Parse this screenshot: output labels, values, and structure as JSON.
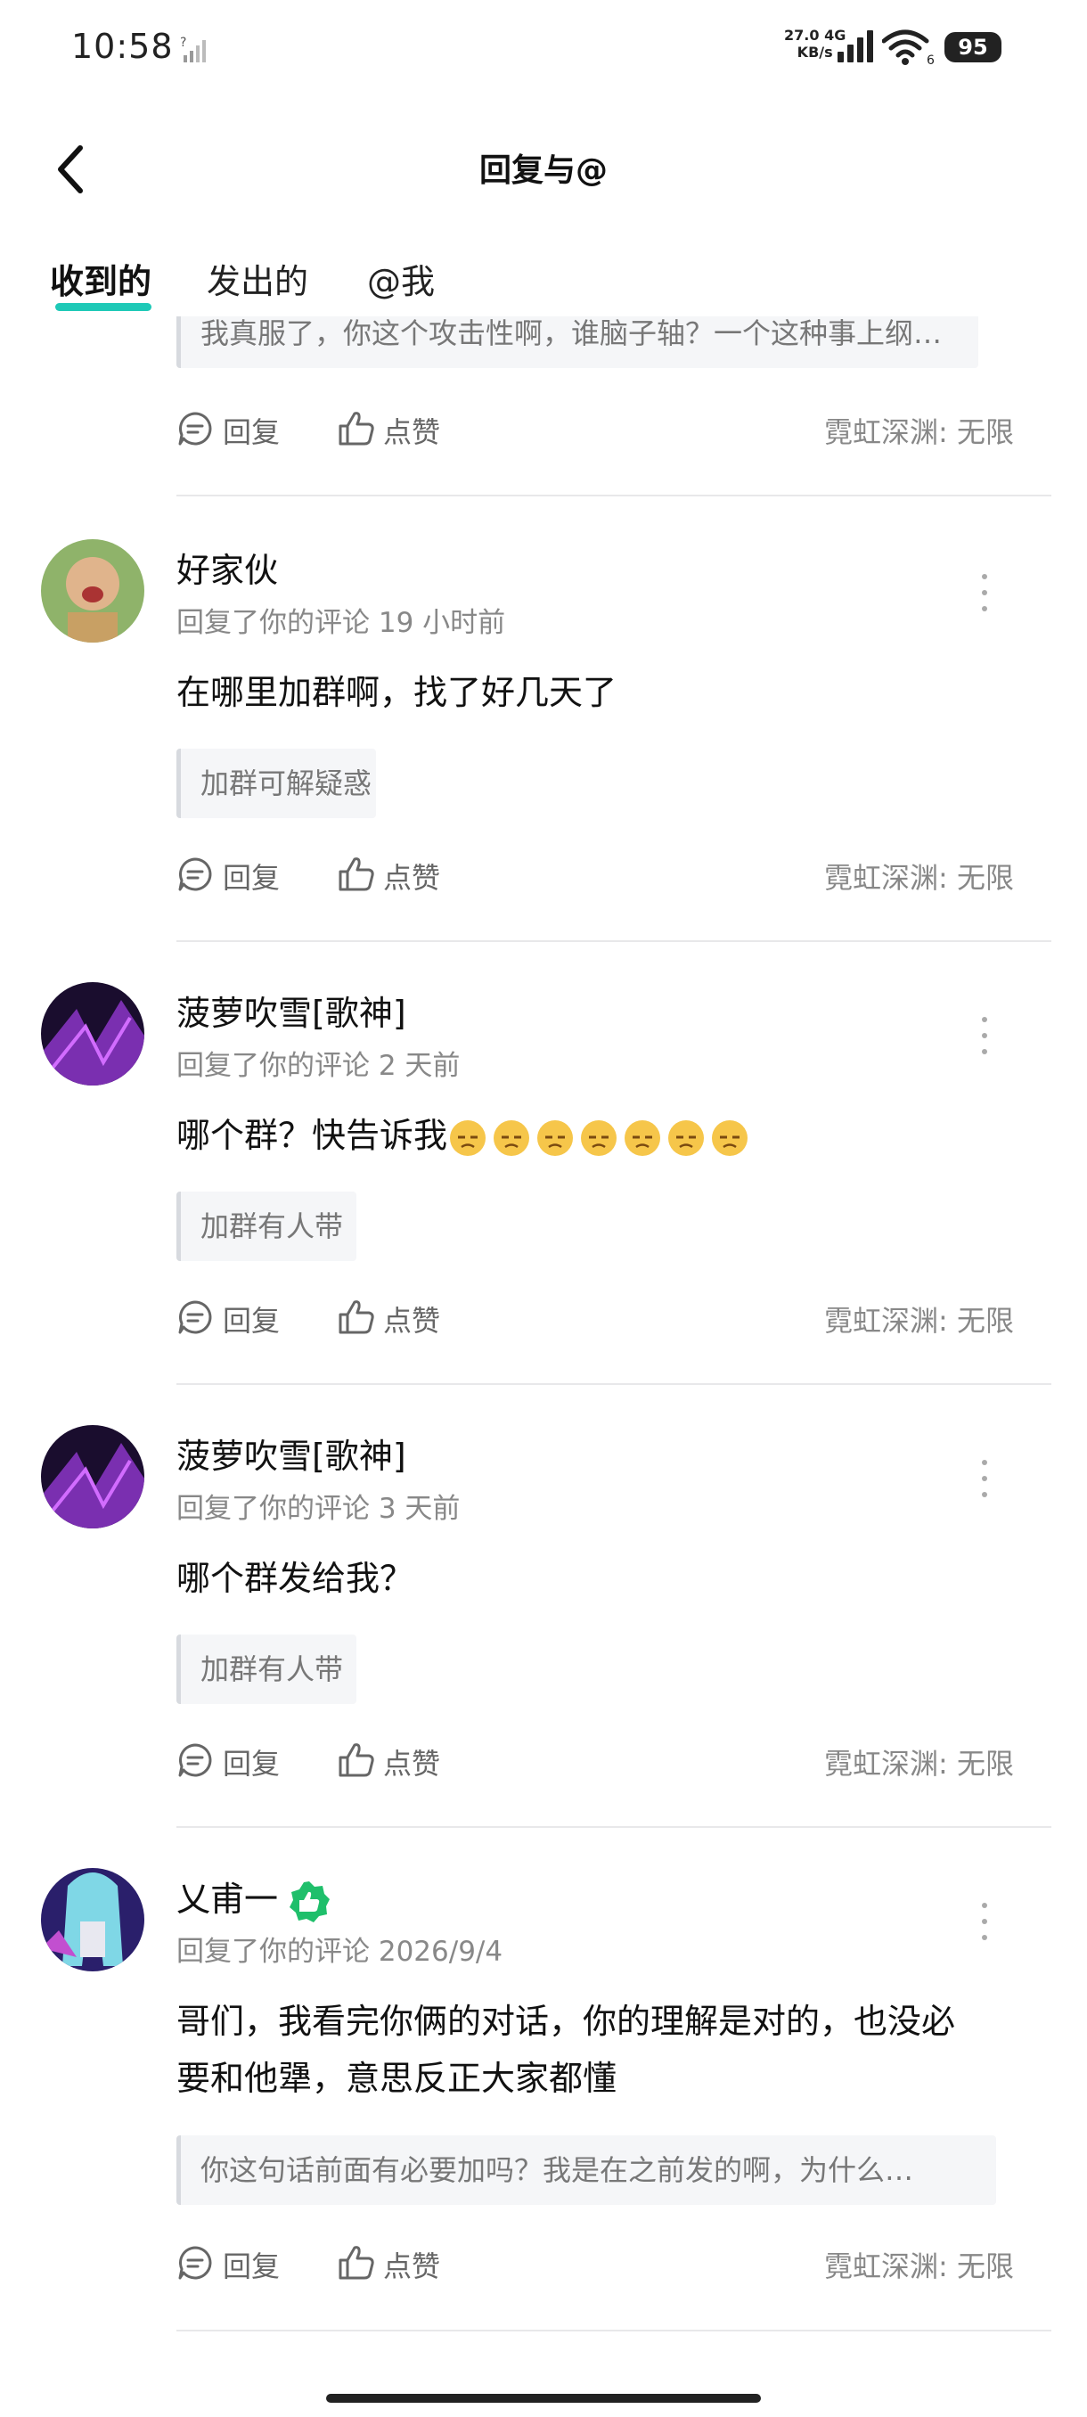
{
  "status_bar": {
    "time": "10:58",
    "net_speed_value": "27.0",
    "net_type": "4G",
    "net_speed_unit": "KB/s",
    "wifi_sub": "6",
    "battery": "95"
  },
  "header": {
    "title": "回复与@"
  },
  "tabs": [
    {
      "label": "收到的",
      "active": true
    },
    {
      "label": "发出的",
      "active": false
    },
    {
      "label": "@我",
      "active": false
    }
  ],
  "actions": {
    "reply_label": "回复",
    "like_label": "点赞"
  },
  "top_partial": {
    "quote": "我真服了，你这个攻击性啊，谁脑子轴？一个这种事上纲…",
    "source": "霓虹深渊: 无限"
  },
  "notifications": [
    {
      "user": "好家伙",
      "meta": "回复了你的评论 19 小时前",
      "text": "在哪里加群啊，找了好几天了",
      "quote": "加群可解疑惑",
      "source": "霓虹深渊: 无限"
    },
    {
      "user": "菠萝吹雪[歌神]",
      "meta": "回复了你的评论 2 天前",
      "text": "哪个群？快告诉我",
      "quote": "加群有人带",
      "source": "霓虹深渊: 无限"
    },
    {
      "user": "菠萝吹雪[歌神]",
      "meta": "回复了你的评论 3 天前",
      "text": "哪个群发给我？",
      "quote": "加群有人带",
      "source": "霓虹深渊: 无限"
    },
    {
      "user": "乂甫一",
      "meta": "回复了你的评论 2026/9/4",
      "text_line1": "哥们，我看完你俩的对话，你的理解是对的，也没必",
      "text_line2": "要和他犟，意思反正大家都懂",
      "quote": "你这句话前面有必要加吗？我是在之前发的啊，为什么…",
      "source": "霓虹深渊: 无限"
    }
  ],
  "colors": {
    "accent": "#1ec9b7",
    "badge_green": "#1fbf6b"
  }
}
